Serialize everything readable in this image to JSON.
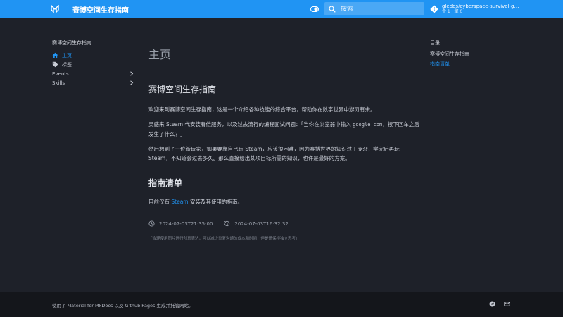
{
  "header": {
    "site_title": "赛博空间生存指南",
    "search_placeholder": "搜索",
    "repo_name": "gledos/cyberspace-survival-guide",
    "repo_meta": "合 1 · 擎 0"
  },
  "nav": {
    "title": "赛博空间生存指南",
    "items": [
      {
        "label": "主页",
        "icon": "home-icon",
        "active": true
      },
      {
        "label": "标签",
        "icon": "tag-icon",
        "active": false
      },
      {
        "label": "Events",
        "icon": "chevron-right-icon",
        "active": false
      },
      {
        "label": "Skills",
        "icon": "chevron-right-icon",
        "active": false
      }
    ]
  },
  "main": {
    "page_title": "主页",
    "section1_title": "赛博空间生存指南",
    "p1": "欢迎来到赛博空间生存指南，这是一个介绍各种技能的综合平台，帮助你在数字世界中游刃有余。",
    "p2_a": "灵感来 Steam 代安装有偿服务，以及过去流行的编程面试问题：「当你在浏览器中输入",
    "p2_code": "google.com",
    "p2_b": "，按下回车之后发生了什么？」",
    "p3": "然后想到了一位新玩家，如果要靠自己玩 Steam，应该很困难，因为赛博世界的知识过于庞杂，学完后再玩 Steam，不知道会过去多久。那么直接给出某项目标所需的知识，也许是最好的方案。",
    "section2_title": "指南清单",
    "p4_a": "目前仅有 ",
    "p4_link": "Steam",
    "p4_b": " 安装及其使用的指南。",
    "date_created": "2024-07-03T21:35:00",
    "date_updated": "2024-07-03T16:32:32",
    "note": "「合理使用图片进行创意表达，可以减少重复沟通的成本和时间，但是请保持独立思考」"
  },
  "toc": {
    "title": "目录",
    "items": [
      {
        "label": "赛博空间生存指南",
        "active": false
      },
      {
        "label": "指南清单",
        "active": true
      }
    ]
  },
  "footer": {
    "text": "使用了 Material for MkDocs 以及 Github Pages 生成并托管网站。"
  },
  "colors": {
    "accent": "#2094f3",
    "background": "#1e2129",
    "footer_bg": "#14161b"
  }
}
